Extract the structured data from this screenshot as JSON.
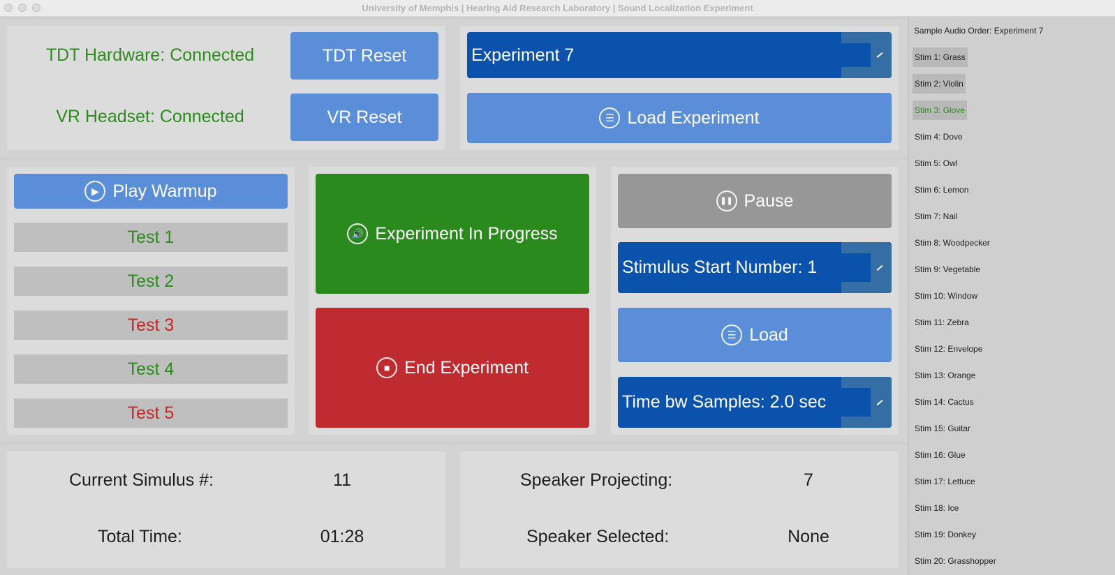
{
  "window": {
    "title": "University of Memphis | Hearing Aid Research Laboratory | Sound Localization Experiment"
  },
  "status": {
    "tdt": "TDT Hardware: Connected",
    "vr": "VR Headset: Connected",
    "color": "#2e8b1e"
  },
  "buttons": {
    "tdt_reset": "TDT Reset",
    "vr_reset": "VR Reset",
    "load_experiment": "Load Experiment",
    "play_warmup": "Play Warmup",
    "experiment_in_progress": "Experiment In Progress",
    "end_experiment": "End Experiment",
    "pause": "Pause",
    "load": "Load"
  },
  "dropdowns": {
    "experiment": "Experiment 7",
    "stimulus_start": "Stimulus Start Number: 1",
    "time_bw_samples": "Time bw Samples: 2.0 sec"
  },
  "tests": [
    {
      "label": "Test 1",
      "color": "#2e8b1e"
    },
    {
      "label": "Test 2",
      "color": "#2e8b1e"
    },
    {
      "label": "Test 3",
      "color": "#c62828"
    },
    {
      "label": "Test 4",
      "color": "#2e8b1e"
    },
    {
      "label": "Test 5",
      "color": "#c62828"
    }
  ],
  "info": {
    "current_stimulus_label": "Current Simulus #:",
    "current_stimulus_value": "11",
    "total_time_label": "Total Time:",
    "total_time_value": "01:28",
    "speaker_projecting_label": "Speaker Projecting:",
    "speaker_projecting_value": "7",
    "speaker_selected_label": "Speaker Selected:",
    "speaker_selected_value": "None"
  },
  "sidebar": {
    "header": "Sample Audio Order: Experiment 7",
    "items": [
      {
        "label": "Stim 1: Grass",
        "state": "played"
      },
      {
        "label": "Stim 2: Violin",
        "state": "played"
      },
      {
        "label": "Stim 3: Glove",
        "state": "current"
      },
      {
        "label": "Stim 4: Dove",
        "state": "pending"
      },
      {
        "label": "Stim 5: Owl",
        "state": "pending"
      },
      {
        "label": "Stim 6: Lemon",
        "state": "pending"
      },
      {
        "label": "Stim 7: Nail",
        "state": "pending"
      },
      {
        "label": "Stim 8: Woodpecker",
        "state": "pending"
      },
      {
        "label": "Stim 9: Vegetable",
        "state": "pending"
      },
      {
        "label": "Stim 10: Window",
        "state": "pending"
      },
      {
        "label": "Stim 11: Zebra",
        "state": "pending"
      },
      {
        "label": "Stim 12: Envelope",
        "state": "pending"
      },
      {
        "label": "Stim 13: Orange",
        "state": "pending"
      },
      {
        "label": "Stim 14: Cactus",
        "state": "pending"
      },
      {
        "label": "Stim 15: Guitar",
        "state": "pending"
      },
      {
        "label": "Stim 16: Glue",
        "state": "pending"
      },
      {
        "label": "Stim 17: Lettuce",
        "state": "pending"
      },
      {
        "label": "Stim 18: Ice",
        "state": "pending"
      },
      {
        "label": "Stim 19: Donkey",
        "state": "pending"
      },
      {
        "label": "Stim 20: Grasshopper",
        "state": "pending"
      }
    ]
  },
  "icons": {
    "menu": "☰",
    "play": "▶",
    "speaker": "🔊",
    "stop": "■",
    "pause": "❚❚"
  }
}
